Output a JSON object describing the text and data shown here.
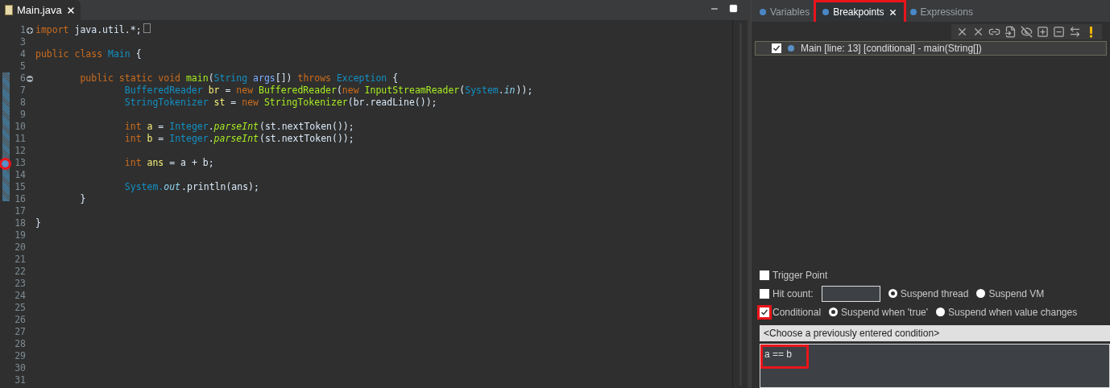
{
  "editor": {
    "tab": {
      "label": "Main.java",
      "selected": true
    },
    "lines": [
      {
        "number": "1",
        "collapsed": true,
        "tokens": [
          {
            "kind": "keyword",
            "text": "import"
          },
          {
            "kind": "plain",
            "text": " java.util.*;"
          }
        ]
      },
      {
        "number": "3"
      },
      {
        "number": "4",
        "tokens": [
          {
            "kind": "keyword",
            "text": "public class"
          },
          {
            "kind": "type",
            "text": " Main"
          },
          {
            "kind": "plain",
            "text": " {"
          }
        ]
      },
      {
        "number": "5"
      },
      {
        "number": "6",
        "collapsed": false,
        "tokens": [
          {
            "kind": "keyword",
            "text": "\tpublic static void"
          },
          {
            "kind": "method",
            "text": " main"
          },
          {
            "kind": "plain",
            "text": "("
          },
          {
            "kind": "type",
            "text": "String"
          },
          {
            "kind": "param",
            "text": " args"
          },
          {
            "kind": "plain",
            "text": "[]) "
          },
          {
            "kind": "keyword",
            "text": "throws"
          },
          {
            "kind": "type",
            "text": " Exception"
          },
          {
            "kind": "plain",
            "text": " {"
          }
        ]
      },
      {
        "number": "7",
        "tokens": [
          {
            "kind": "type",
            "text": "\t\tBufferedReader"
          },
          {
            "kind": "var",
            "text": " br"
          },
          {
            "kind": "plain",
            "text": " = "
          },
          {
            "kind": "keyword",
            "text": "new"
          },
          {
            "kind": "method",
            "text": " BufferedReader"
          },
          {
            "kind": "plain",
            "text": "("
          },
          {
            "kind": "keyword",
            "text": "new"
          },
          {
            "kind": "method",
            "text": " InputStreamReader"
          },
          {
            "kind": "plain",
            "text": "("
          },
          {
            "kind": "type",
            "text": "System"
          },
          {
            "kind": "plain",
            "text": "."
          },
          {
            "kind": "field",
            "text": "in"
          },
          {
            "kind": "plain",
            "text": "));"
          }
        ]
      },
      {
        "number": "8",
        "tokens": [
          {
            "kind": "type",
            "text": "\t\tStringTokenizer"
          },
          {
            "kind": "var",
            "text": " st"
          },
          {
            "kind": "plain",
            "text": " = "
          },
          {
            "kind": "keyword",
            "text": "new"
          },
          {
            "kind": "method",
            "text": " StringTokenizer"
          },
          {
            "kind": "plain",
            "text": "(br.readLine());"
          }
        ]
      },
      {
        "number": "9"
      },
      {
        "number": "10",
        "tokens": [
          {
            "kind": "keyword",
            "text": "\t\tint"
          },
          {
            "kind": "var",
            "text": " a"
          },
          {
            "kind": "plain",
            "text": " = "
          },
          {
            "kind": "type",
            "text": "Integer"
          },
          {
            "kind": "plain",
            "text": "."
          },
          {
            "kind": "static",
            "text": "parseInt"
          },
          {
            "kind": "plain",
            "text": "(st.nextToken());"
          }
        ]
      },
      {
        "number": "11",
        "tokens": [
          {
            "kind": "keyword",
            "text": "\t\tint"
          },
          {
            "kind": "var",
            "text": " b"
          },
          {
            "kind": "plain",
            "text": " = "
          },
          {
            "kind": "type",
            "text": "Integer"
          },
          {
            "kind": "plain",
            "text": "."
          },
          {
            "kind": "static",
            "text": "parseInt"
          },
          {
            "kind": "plain",
            "text": "(st.nextToken());"
          }
        ]
      },
      {
        "number": "12"
      },
      {
        "number": "13",
        "breakpoint": true,
        "highlighted": true,
        "tokens": [
          {
            "kind": "keyword",
            "text": "\t\tint"
          },
          {
            "kind": "var",
            "text": " ans"
          },
          {
            "kind": "plain",
            "text": " = a + b;"
          }
        ]
      },
      {
        "number": "14"
      },
      {
        "number": "15",
        "tokens": [
          {
            "kind": "type",
            "text": "\t\tSystem."
          },
          {
            "kind": "field",
            "text": "out"
          },
          {
            "kind": "plain",
            "text": ".println(ans);"
          }
        ]
      },
      {
        "number": "16",
        "tokens": [
          {
            "kind": "plain",
            "text": "\t}"
          }
        ]
      },
      {
        "number": "17"
      },
      {
        "number": "18",
        "tokens": [
          {
            "kind": "plain",
            "text": "}"
          }
        ]
      },
      {
        "number": "19"
      },
      {
        "number": "20"
      },
      {
        "number": "21"
      },
      {
        "number": "22"
      },
      {
        "number": "23"
      },
      {
        "number": "24"
      },
      {
        "number": "25"
      },
      {
        "number": "26"
      },
      {
        "number": "27"
      },
      {
        "number": "28"
      },
      {
        "number": "29"
      },
      {
        "number": "30"
      },
      {
        "number": "31"
      }
    ]
  },
  "debug_panel": {
    "tabs": [
      {
        "label": "Variables",
        "selected": false,
        "highlighted": false
      },
      {
        "label": "Breakpoints",
        "selected": true,
        "highlighted": true
      },
      {
        "label": "Expressions",
        "selected": false,
        "highlighted": false
      }
    ],
    "breakpoints": [
      {
        "label": "Main [line: 13] [conditional] - main(String[])",
        "checked": true
      }
    ],
    "options": [
      {
        "kind": "checkbox",
        "label": "Trigger Point",
        "checked": false,
        "highlighted": false
      },
      {
        "kind": "break"
      },
      {
        "kind": "checkbox",
        "label": "Hit count:",
        "checked": false,
        "highlighted": false
      },
      {
        "kind": "field"
      },
      {
        "kind": "radio",
        "label": "Suspend thread",
        "selected": true
      },
      {
        "kind": "radio",
        "label": "Suspend VM",
        "selected": false
      },
      {
        "kind": "break"
      },
      {
        "kind": "checkbox",
        "label": "Conditional",
        "checked": true,
        "highlighted": true
      },
      {
        "kind": "radio",
        "label": "Suspend when 'true'",
        "selected": true
      },
      {
        "kind": "radio",
        "label": "Suspend when value changes",
        "selected": false
      }
    ],
    "condition_history": {
      "placeholder": "<Choose a previously entered condition>"
    },
    "condition": {
      "value": "a == b",
      "highlighted": true
    }
  }
}
